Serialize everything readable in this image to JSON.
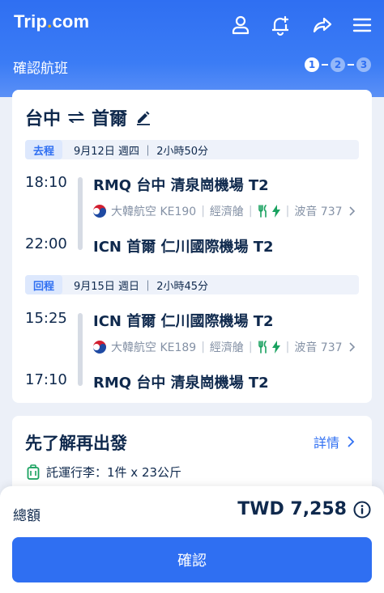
{
  "header": {
    "logo_main": "Trip",
    "logo_dot": ".",
    "logo_suffix": "com",
    "icons": [
      "account-icon",
      "notification-bell-icon",
      "share-icon",
      "menu-icon"
    ],
    "subtitle": "確認航班",
    "steps": [
      "1",
      "2",
      "3"
    ],
    "current_step": 1
  },
  "trip": {
    "origin": "台中",
    "destination": "首爾",
    "outbound": {
      "tag": "去程",
      "summary": "9月12日 週四 ｜ 2小時50分",
      "depart_time": "18:10",
      "depart_airport": "RMQ 台中 清泉崗機場 T2",
      "airline": "大韓航空 KE190",
      "cabin": "經濟艙",
      "aircraft": "波音 737",
      "arrive_time": "22:00",
      "arrive_airport": "ICN 首爾 仁川國際機場 T2"
    },
    "return": {
      "tag": "回程",
      "summary": "9月15日 週日 ｜ 2小時45分",
      "depart_time": "15:25",
      "depart_airport": "ICN 首爾 仁川國際機場 T2",
      "airline": "大韓航空 KE189",
      "cabin": "經濟艙",
      "aircraft": "波音 737",
      "arrive_time": "17:10",
      "arrive_airport": "RMQ 台中 清泉崗機場 T2"
    }
  },
  "prepare": {
    "title": "先了解再出發",
    "details_link": "詳情",
    "baggage": "託運行李：1件 x 23公斤"
  },
  "footer": {
    "total_label": "總額",
    "total_price": "TWD 7,258",
    "confirm_label": "確認"
  },
  "colors": {
    "brand_blue": "#2f6ff2",
    "logo_dot": "#ffb300",
    "baggage_green": "#1aa260"
  }
}
